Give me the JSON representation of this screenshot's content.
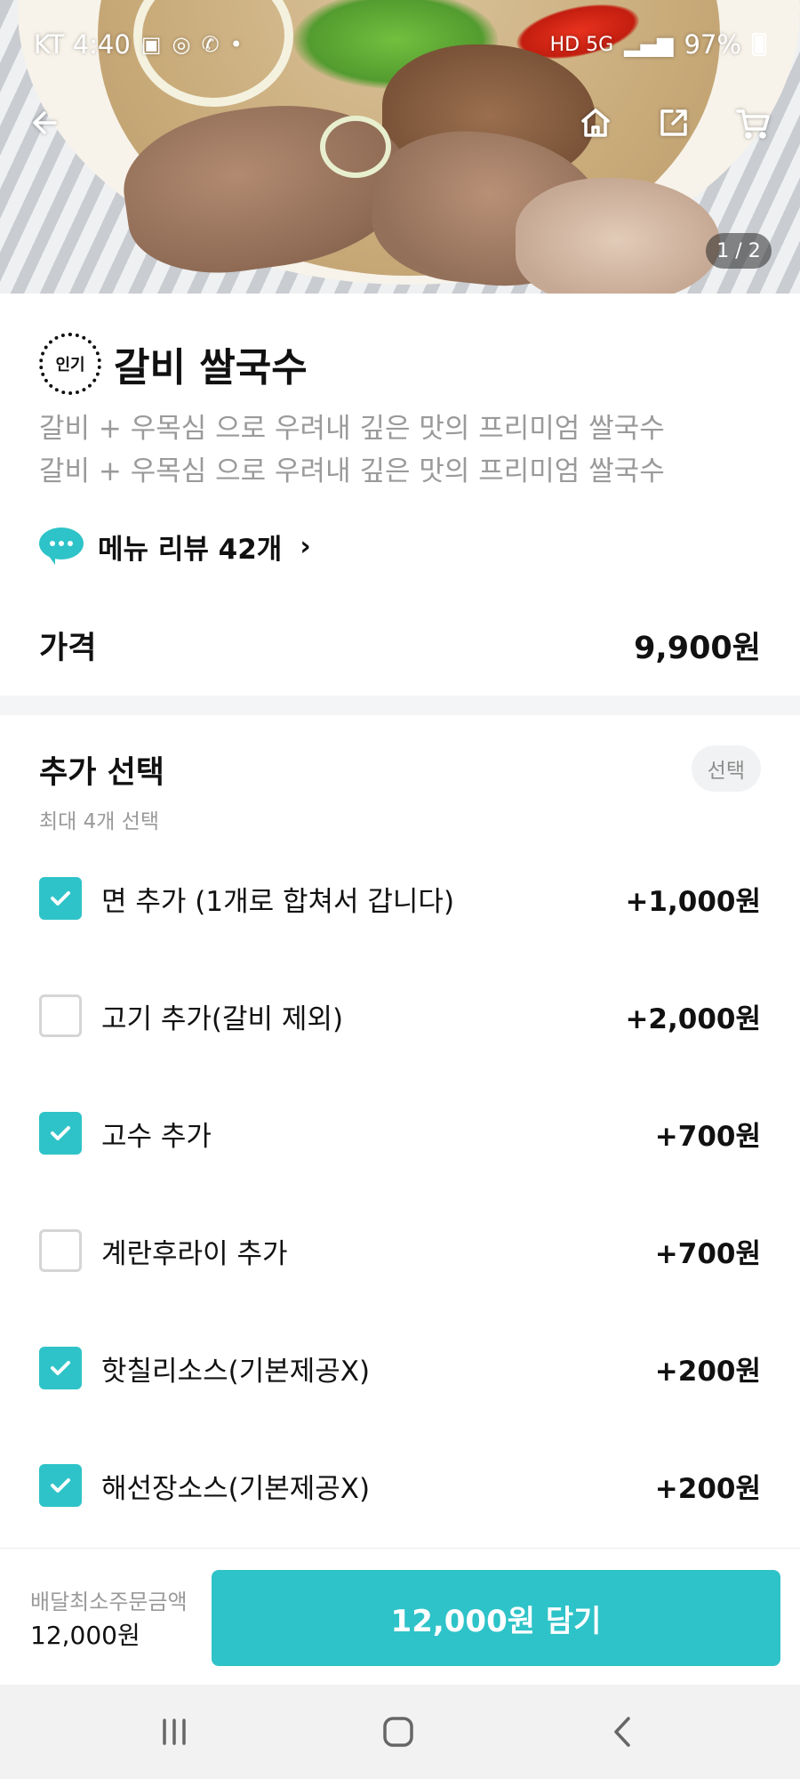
{
  "status": {
    "carrier_time": "KT 4:40",
    "network": "HD 5G",
    "battery": "97%"
  },
  "hero": {
    "pager": "1 / 2"
  },
  "menu": {
    "badge": "인기",
    "title": "갈비 쌀국수",
    "description_line1": "갈비 + 우목심 으로 우려내 깊은 맛의 프리미엄 쌀국수",
    "description_line2": "갈비 + 우목심 으로 우려내 깊은 맛의 프리미엄 쌀국수",
    "review_link": "메뉴 리뷰 42개",
    "price_label": "가격",
    "price_value": "9,900원"
  },
  "options": {
    "title": "추가 선택",
    "badge": "선택",
    "subtitle": "최대 4개 선택",
    "items": [
      {
        "name": "면 추가 (1개로 합쳐서 갑니다)",
        "price": "+1,000원",
        "checked": true
      },
      {
        "name": "고기 추가(갈비 제외)",
        "price": "+2,000원",
        "checked": false
      },
      {
        "name": "고수 추가",
        "price": "+700원",
        "checked": true
      },
      {
        "name": "계란후라이 추가",
        "price": "+700원",
        "checked": false
      },
      {
        "name": "핫칠리소스(기본제공X)",
        "price": "+200원",
        "checked": true
      },
      {
        "name": "해선장소스(기본제공X)",
        "price": "+200원",
        "checked": true
      }
    ]
  },
  "bottom": {
    "min_order_label": "배달최소주문금액",
    "min_order_value": "12,000원",
    "add_button": "12,000원 담기"
  },
  "colors": {
    "accent": "#2ec3c8",
    "muted_text": "#9a9a9a"
  },
  "icons": [
    "back-arrow-icon",
    "home-icon",
    "share-icon",
    "cart-icon",
    "chat-bubble-icon",
    "chevron-right-icon",
    "checkmark-icon",
    "recent-apps-icon",
    "home-key-icon",
    "back-key-icon"
  ]
}
